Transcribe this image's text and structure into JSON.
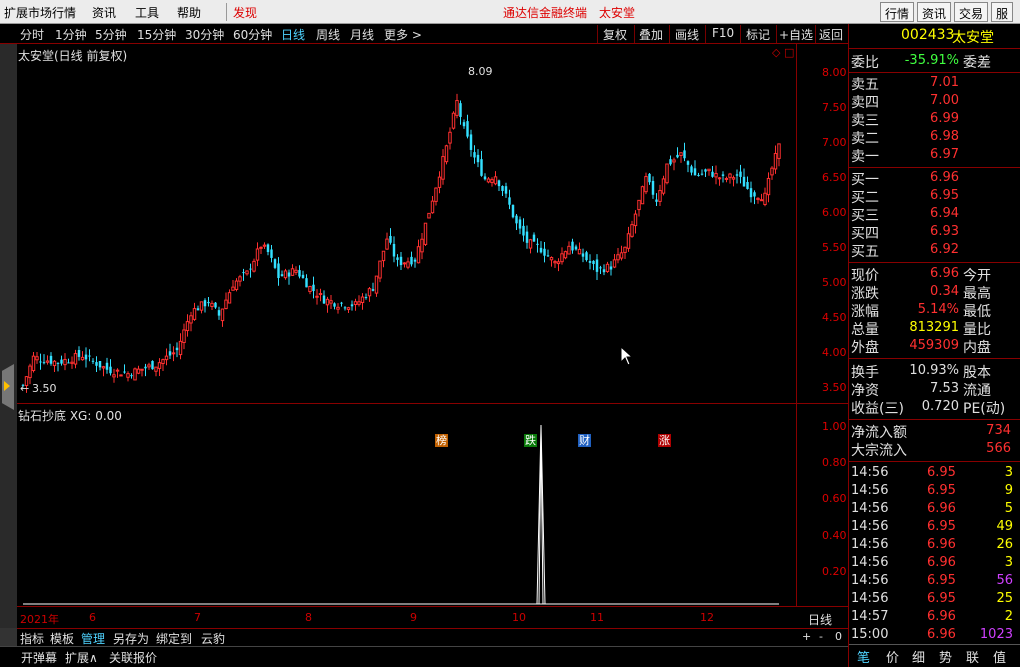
{
  "topbar": {
    "menus": [
      "扩展市场行情",
      "资讯",
      "工具",
      "帮助"
    ],
    "discover": "发现",
    "app_title": "通达信金融终端",
    "stock_name": "太安堂",
    "right_buttons": [
      "行情",
      "资讯",
      "交易",
      "服"
    ]
  },
  "toolbar": {
    "timeframes": [
      "分时",
      "1分钟",
      "5分钟",
      "15分钟",
      "30分钟",
      "60分钟",
      "日线",
      "周线",
      "月线",
      "更多 >"
    ],
    "active_timeframe": "日线",
    "buttons": [
      "复权",
      "叠加",
      "画线",
      "F10",
      "标记",
      "+自选",
      "返回"
    ]
  },
  "chart": {
    "title": "太安堂(日线 前复权)",
    "high_label": "8.09",
    "low_label": "3.50",
    "events": [
      {
        "label": "榜",
        "color": "#c06000"
      },
      {
        "label": "跌",
        "color": "#0a7a0a"
      },
      {
        "label": "财",
        "color": "#2060c0"
      },
      {
        "label": "涨",
        "color": "#b00000"
      }
    ],
    "indicator_label": "钻石抄底 XG: 0.00",
    "x_labels": [
      "2021年",
      "6",
      "7",
      "8",
      "9",
      "10",
      "11",
      "12"
    ],
    "period_label": "日线",
    "up_color": "#ff3030",
    "down_color": "#33e0ff"
  },
  "chart_data": {
    "type": "candlestick",
    "price_axis": {
      "min": 3.5,
      "max": 8.0,
      "ticks": [
        "8.00",
        "7.50",
        "7.00",
        "6.50",
        "6.00",
        "5.50",
        "5.00",
        "4.50",
        "4.00",
        "3.50"
      ]
    },
    "indicator_axis": {
      "min": 0,
      "max": 1.0,
      "ticks": [
        "1.00",
        "0.80",
        "0.60",
        "0.40",
        "0.20"
      ]
    },
    "close_anchors": [
      [
        0,
        3.55
      ],
      [
        3,
        3.95
      ],
      [
        10,
        3.88
      ],
      [
        17,
        3.98
      ],
      [
        24,
        3.78
      ],
      [
        30,
        3.72
      ],
      [
        38,
        3.85
      ],
      [
        44,
        4.05
      ],
      [
        48,
        4.6
      ],
      [
        53,
        4.75
      ],
      [
        56,
        4.55
      ],
      [
        60,
        5.0
      ],
      [
        64,
        5.15
      ],
      [
        68,
        5.55
      ],
      [
        70,
        5.45
      ],
      [
        73,
        5.1
      ],
      [
        78,
        5.2
      ],
      [
        82,
        4.95
      ],
      [
        86,
        4.78
      ],
      [
        90,
        4.72
      ],
      [
        95,
        4.7
      ],
      [
        100,
        4.95
      ],
      [
        104,
        5.65
      ],
      [
        107,
        5.3
      ],
      [
        112,
        5.35
      ],
      [
        115,
        5.85
      ],
      [
        118,
        6.4
      ],
      [
        121,
        6.95
      ],
      [
        124,
        7.6
      ],
      [
        126,
        7.2
      ],
      [
        129,
        6.8
      ],
      [
        132,
        6.5
      ],
      [
        135,
        6.55
      ],
      [
        138,
        6.25
      ],
      [
        141,
        5.85
      ],
      [
        144,
        5.6
      ],
      [
        148,
        5.5
      ],
      [
        152,
        5.3
      ],
      [
        156,
        5.55
      ],
      [
        160,
        5.4
      ],
      [
        164,
        5.2
      ],
      [
        168,
        5.25
      ],
      [
        172,
        5.5
      ],
      [
        175,
        6.0
      ],
      [
        178,
        6.5
      ],
      [
        181,
        6.2
      ],
      [
        184,
        6.7
      ],
      [
        188,
        6.85
      ],
      [
        192,
        6.55
      ],
      [
        196,
        6.6
      ],
      [
        200,
        6.5
      ],
      [
        204,
        6.55
      ],
      [
        208,
        6.3
      ],
      [
        212,
        6.25
      ],
      [
        214,
        6.65
      ],
      [
        216,
        6.96
      ]
    ],
    "xg_spike_index": 148
  },
  "bottom_tabs": [
    "指标",
    "模板",
    "管理",
    "另存为",
    "绑定到",
    "云豹"
  ],
  "bottom_active": "管理",
  "zoom_buttons": [
    "+",
    "-",
    "0"
  ],
  "footer_tabs": [
    "开弹幕",
    "扩展∧",
    "关联报价"
  ],
  "quote": {
    "code": "002433",
    "name": "太安堂",
    "weibi_label": "委比",
    "weibi": "-35.91%",
    "weicha_label": "委差",
    "asks": [
      {
        "label": "卖五",
        "price": "7.01",
        "vol": ""
      },
      {
        "label": "卖四",
        "price": "7.00",
        "vol": ""
      },
      {
        "label": "卖三",
        "price": "6.99",
        "vol": ""
      },
      {
        "label": "卖二",
        "price": "6.98",
        "vol": ""
      },
      {
        "label": "卖一",
        "price": "6.97",
        "vol": ""
      }
    ],
    "bids": [
      {
        "label": "买一",
        "price": "6.96",
        "vol": ""
      },
      {
        "label": "买二",
        "price": "6.95",
        "vol": ""
      },
      {
        "label": "买三",
        "price": "6.94",
        "vol": ""
      },
      {
        "label": "买四",
        "price": "6.93",
        "vol": ""
      },
      {
        "label": "买五",
        "price": "6.92",
        "vol": ""
      }
    ],
    "stats": [
      {
        "l1": "现价",
        "v1": "6.96",
        "c1": "#ff3030",
        "l2": "今开",
        "v2": ""
      },
      {
        "l1": "涨跌",
        "v1": "0.34",
        "c1": "#ff3030",
        "l2": "最高",
        "v2": ""
      },
      {
        "l1": "涨幅",
        "v1": "5.14%",
        "c1": "#ff3030",
        "l2": "最低",
        "v2": ""
      },
      {
        "l1": "总量",
        "v1": "813291",
        "c1": "#ffff00",
        "l2": "量比",
        "v2": ""
      },
      {
        "l1": "外盘",
        "v1": "459309",
        "c1": "#ff3030",
        "l2": "内盘",
        "v2": ""
      }
    ],
    "stats2": [
      {
        "l1": "换手",
        "v1": "10.93%",
        "c1": "#e0e0e0",
        "l2": "股本",
        "v2": ""
      },
      {
        "l1": "净资",
        "v1": "7.53",
        "c1": "#e0e0e0",
        "l2": "流通",
        "v2": ""
      },
      {
        "l1": "收益(三)",
        "v1": "0.720",
        "c1": "#e0e0e0",
        "l2": "PE(动)",
        "v2": ""
      }
    ],
    "flows": [
      {
        "label": "净流入额",
        "value": "734"
      },
      {
        "label": "大宗流入",
        "value": "566"
      }
    ],
    "ticks": [
      {
        "time": "14:56",
        "price": "6.95",
        "vol": "3",
        "vc": "#ffff00"
      },
      {
        "time": "14:56",
        "price": "6.95",
        "vol": "9",
        "vc": "#ffff00"
      },
      {
        "time": "14:56",
        "price": "6.96",
        "vol": "5",
        "vc": "#ffff00"
      },
      {
        "time": "14:56",
        "price": "6.95",
        "vol": "49",
        "vc": "#ffff00"
      },
      {
        "time": "14:56",
        "price": "6.96",
        "vol": "26",
        "vc": "#ffff00"
      },
      {
        "time": "14:56",
        "price": "6.96",
        "vol": "3",
        "vc": "#ffff00"
      },
      {
        "time": "14:56",
        "price": "6.95",
        "vol": "56",
        "vc": "#d040ff"
      },
      {
        "time": "14:56",
        "price": "6.95",
        "vol": "25",
        "vc": "#ffff00"
      },
      {
        "time": "14:57",
        "price": "6.96",
        "vol": "2",
        "vc": "#ffff00"
      },
      {
        "time": "15:00",
        "price": "6.96",
        "vol": "1023",
        "vc": "#d040ff"
      }
    ],
    "bottom_tabs": [
      "笔",
      "价",
      "细",
      "势",
      "联",
      "值"
    ]
  }
}
